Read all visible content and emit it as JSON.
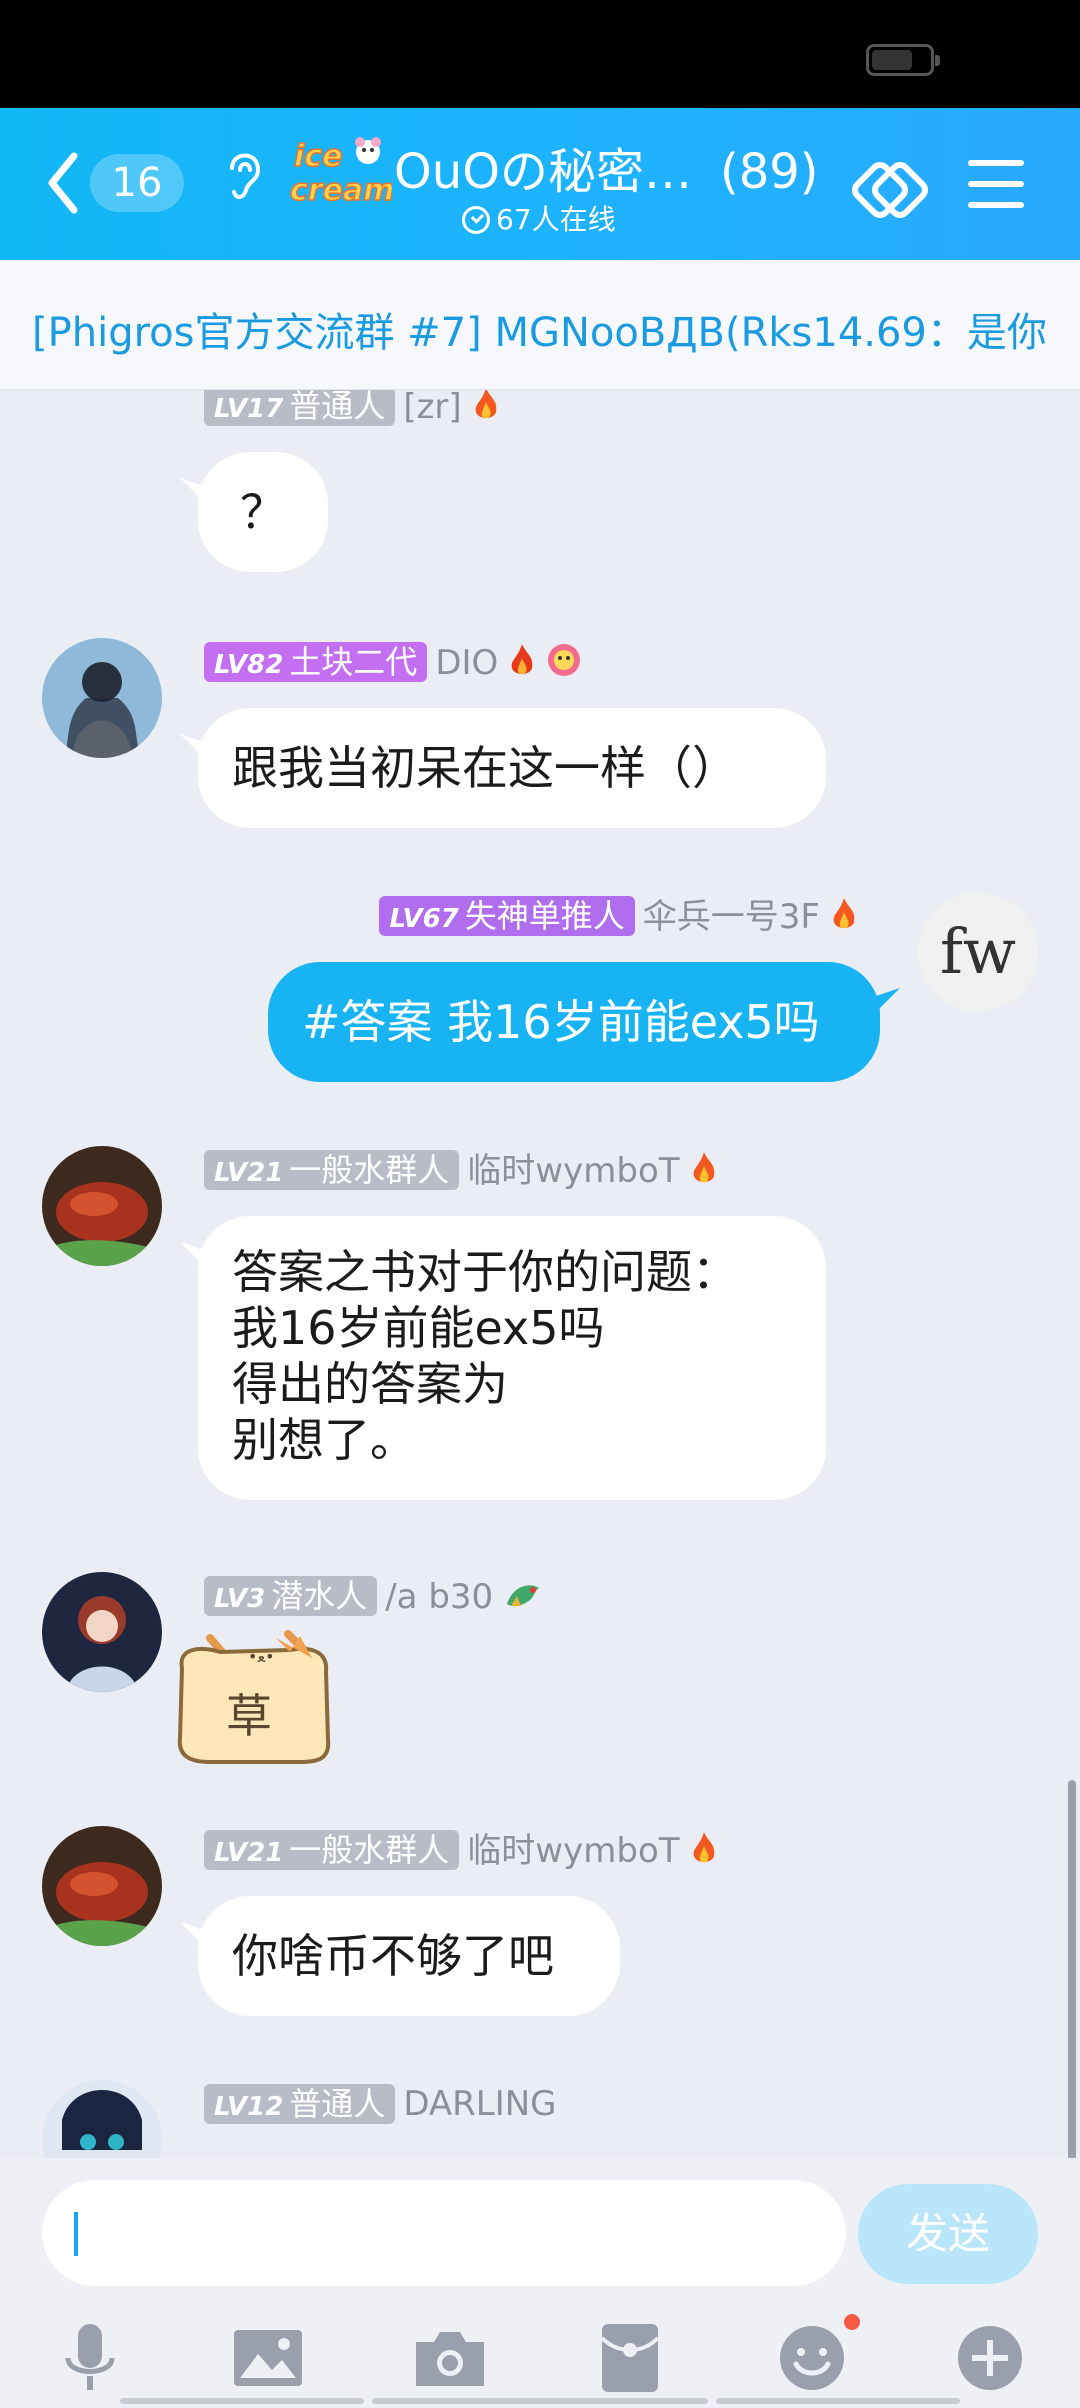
{
  "header": {
    "unread_count": "16",
    "group_title": "OuOの秘密…",
    "member_count": "(89)",
    "online": "67人在线",
    "logo_text": "ice cream"
  },
  "announcement": "[Phigros官方交流群 #7] MGNooBДB(Rks14.69：是你",
  "messages": [
    {
      "level": "LV17",
      "title": "普通人",
      "name": "[zr]",
      "text": "？",
      "side": "left"
    },
    {
      "level": "LV82",
      "title": "土块二代",
      "name": "DIO",
      "text": "跟我当初呆在这一样（）",
      "side": "left"
    },
    {
      "level": "LV67",
      "title": "失神单推人",
      "name": "伞兵一号3F",
      "text": "#答案 我16岁前能ex5吗",
      "side": "right",
      "avatar_text": "fw"
    },
    {
      "level": "LV21",
      "title": "一般水群人",
      "name": "临时wymboT",
      "text": "答案之书对于你的问题：\n我16岁前能ex5吗\n得出的答案为\n别想了。",
      "side": "left"
    },
    {
      "level": "LV3",
      "title": "潜水人",
      "name": "/a b30",
      "sticker_text": "草",
      "side": "left"
    },
    {
      "level": "LV21",
      "title": "一般水群人",
      "name": "临时wymboT",
      "text": "你啥币不够了吧",
      "side": "left"
    },
    {
      "level": "LV12",
      "title": "普通人",
      "name": "DARLING",
      "side": "left"
    }
  ],
  "input": {
    "placeholder": "",
    "send_label": "发送"
  },
  "toolbar": [
    "microphone-icon",
    "image-icon",
    "camera-icon",
    "red-packet-icon",
    "emoji-icon",
    "plus-icon"
  ],
  "colors": {
    "header": "#12b7f5",
    "bubble_mine": "#18b3f3",
    "background": "#eaedf3"
  }
}
